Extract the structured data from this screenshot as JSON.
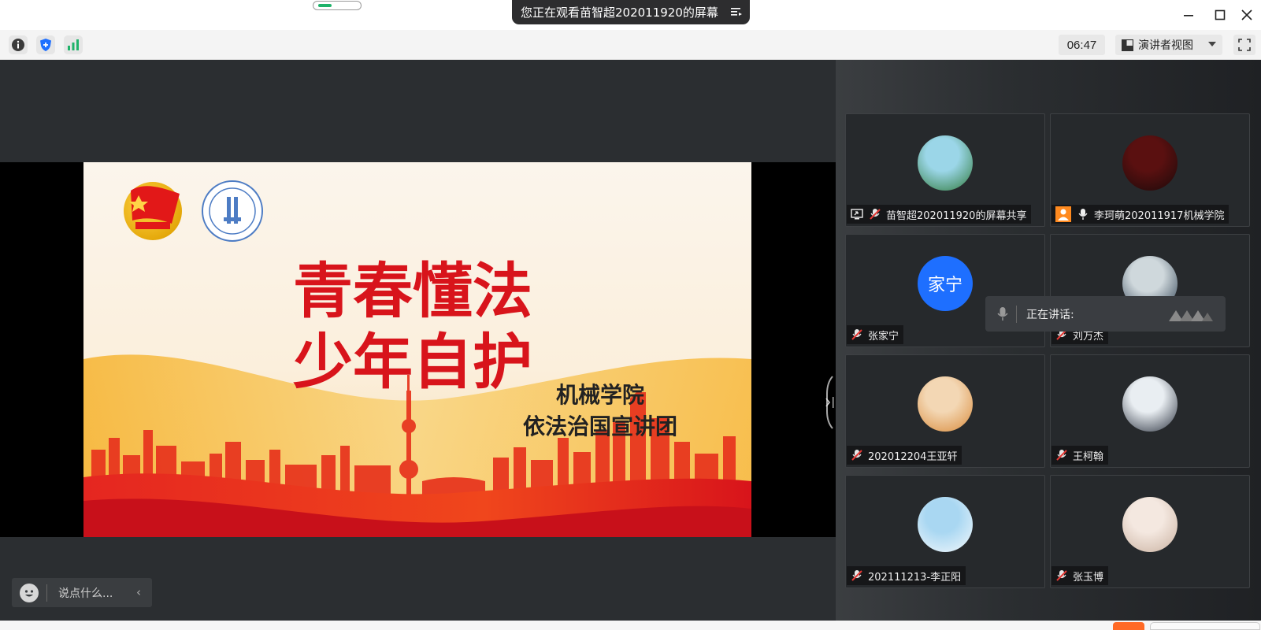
{
  "window": {
    "share_banner_text": "您正在观看苗智超202011920的屏幕",
    "controls": [
      "minimize",
      "maximize",
      "close"
    ]
  },
  "toolbar": {
    "timer": "06:47",
    "view_mode": "演讲者视图"
  },
  "slide": {
    "title_line1": "青春懂法",
    "title_line2": "少年自护",
    "subtitle_line1": "机械学院",
    "subtitle_line2": "依法治国宣讲团"
  },
  "chat": {
    "placeholder": "说点什么..."
  },
  "speaking": {
    "label": "正在讲话:"
  },
  "participants": [
    {
      "name": "苗智超202011920的屏幕共享",
      "avatar": "photo",
      "mic": "muted",
      "share": true,
      "colors": [
        "#9bd6e8",
        "#2f7a3a"
      ]
    },
    {
      "name": "李珂萌202011917机械学院",
      "avatar": "photo",
      "mic": "on",
      "badge": "user-icon",
      "colors": [
        "#5a1010",
        "#1a0a0a"
      ]
    },
    {
      "name": "张家宁",
      "avatar": "text",
      "avatar_text": "家宁",
      "mic": "muted"
    },
    {
      "name": "刘万杰",
      "avatar": "photo",
      "mic": "muted",
      "colors": [
        "#cfd8dc",
        "#2c3e50"
      ]
    },
    {
      "name": "202012204王亚轩",
      "avatar": "photo",
      "mic": "muted",
      "colors": [
        "#f3d7b4",
        "#d98a3a"
      ]
    },
    {
      "name": "王柯翰",
      "avatar": "photo",
      "mic": "muted",
      "colors": [
        "#e9eef2",
        "#2c3340"
      ]
    },
    {
      "name": "202111213-李正阳",
      "avatar": "photo",
      "mic": "muted",
      "colors": [
        "#a9d7f2",
        "#f4f8fb"
      ]
    },
    {
      "name": "张玉博",
      "avatar": "photo",
      "mic": "muted",
      "colors": [
        "#f4e8e0",
        "#c9b1a0"
      ]
    }
  ],
  "colors": {
    "slide_red": "#d8141b",
    "accent_blue": "#1e6fff",
    "muted_red": "#e53935",
    "signal_green": "#1fb36a"
  }
}
